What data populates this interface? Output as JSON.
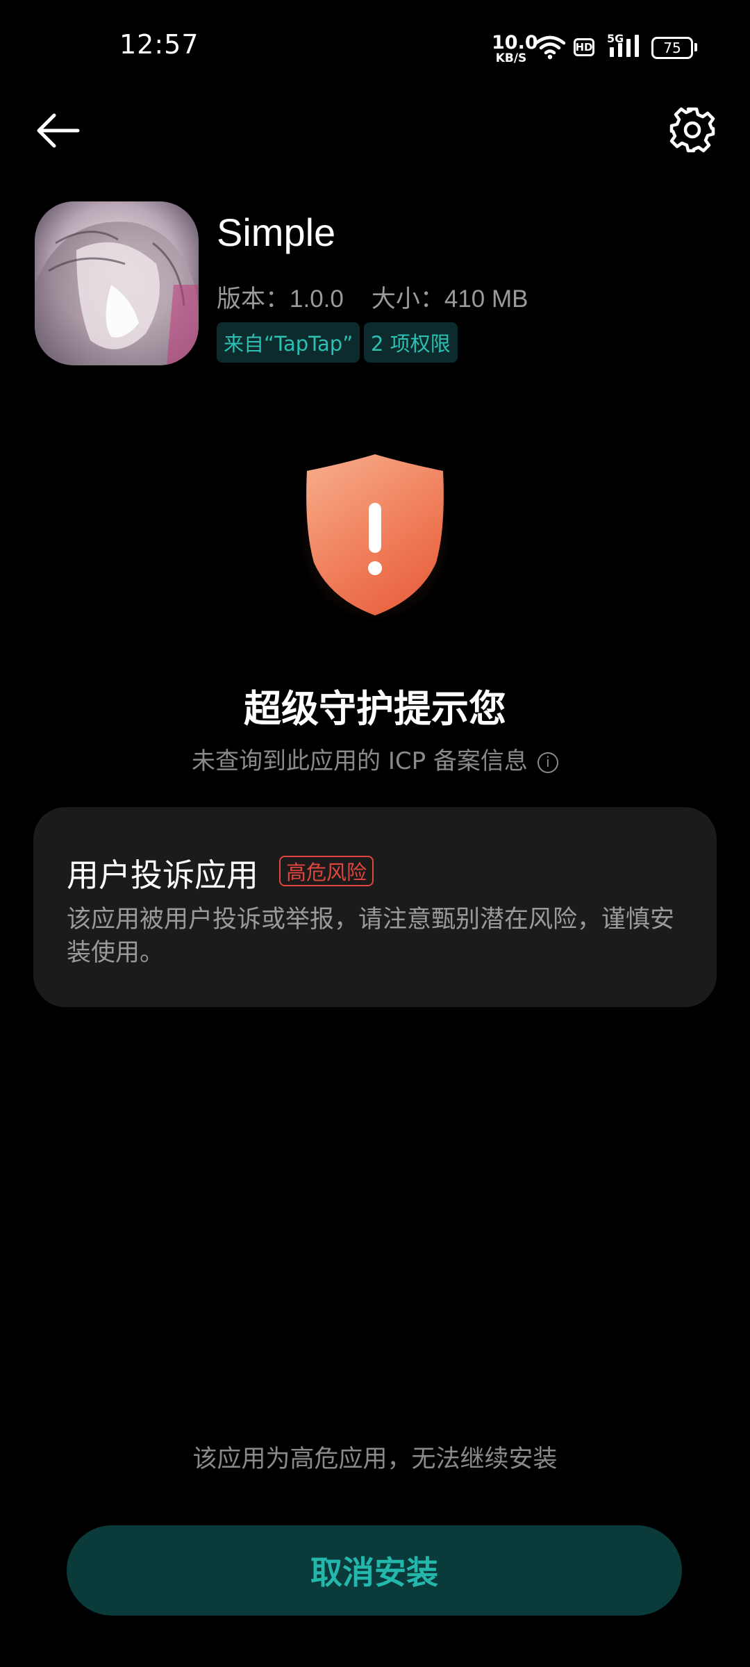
{
  "status_bar": {
    "time": "12:57",
    "net_speed_value": "10.0",
    "net_speed_unit": "KB/S",
    "hd_label": "HD",
    "signal_label": "5G",
    "battery": "75"
  },
  "nav": {
    "back_icon": "arrow-left-icon",
    "settings_icon": "gear-icon"
  },
  "app": {
    "name": "Simple",
    "version": "版本：1.0.0",
    "size": "大小：410 MB",
    "source_chip": "来自“TapTap”",
    "permissions_chip": "2 项权限"
  },
  "warning": {
    "icon": "shield-alert-icon",
    "headline": "超级守护提示您",
    "subline": "未查询到此应用的 ICP 备案信息",
    "info_icon_glyph": "i"
  },
  "risk_card": {
    "title": "用户投诉应用",
    "badge": "高危风险",
    "description": "该应用被用户投诉或举报，请注意甄别潜在风险，谨慎安装使用。"
  },
  "footer": {
    "notice": "该应用为高危应用，无法继续安装",
    "cancel_button": "取消安装"
  },
  "colors": {
    "accent_teal": "#24b8ad",
    "danger_red": "#e0463d",
    "shield_orange": "#f07a55",
    "background": "#000000",
    "card_bg": "#1b1b1b"
  }
}
